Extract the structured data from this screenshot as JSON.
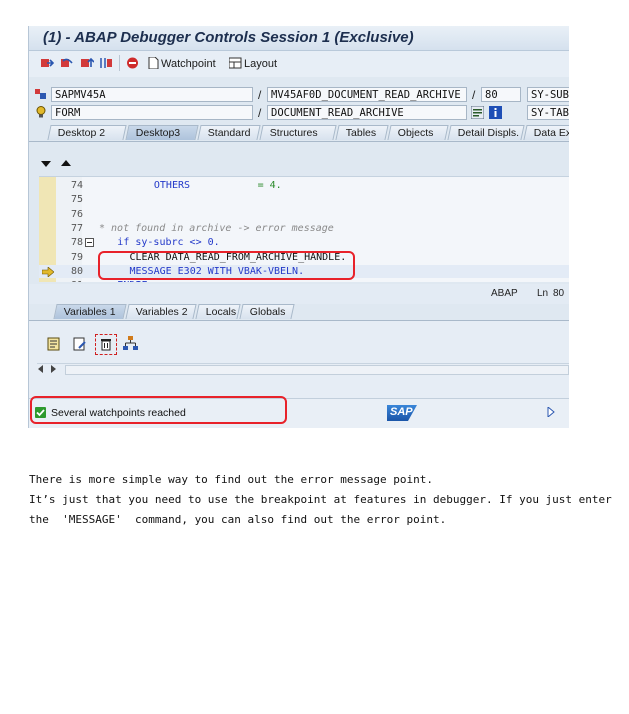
{
  "window": {
    "title": "(1) - ABAP Debugger Controls Session 1 (Exclusive)"
  },
  "toolbar": {
    "watchpoint_label": "Watchpoint",
    "layout_label": "Layout"
  },
  "context": {
    "program": "SAPMV45A",
    "include": "MV45AF0D_DOCUMENT_READ_ARCHIVE",
    "line": "80",
    "sysvar1": "SY-SUB",
    "event_type": "FORM",
    "event_name": "DOCUMENT_READ_ARCHIVE",
    "sysvar2": "SY-TAB"
  },
  "tabs": [
    "Desktop 2",
    "Desktop3",
    "Standard",
    "Structures",
    "Tables",
    "Objects",
    "Detail Displs.",
    "Data Explo"
  ],
  "active_tab": "Desktop3",
  "code": [
    {
      "n": "74",
      "text": "OTHERS",
      "extra": "= 4.",
      "style": "kw",
      "indent": 9
    },
    {
      "n": "75",
      "text": "",
      "style": "plain",
      "indent": 0
    },
    {
      "n": "76",
      "text": "",
      "style": "plain",
      "indent": 0
    },
    {
      "n": "77",
      "text": "* not found in archive -> error message",
      "style": "cm",
      "indent": 0
    },
    {
      "n": "78",
      "text": "if sy-subrc <> 0.",
      "style": "kw",
      "indent": 3
    },
    {
      "n": "79",
      "text": "CLEAR DATA_READ_FROM_ARCHIVE_HANDLE.",
      "style": "plain",
      "indent": 5
    },
    {
      "n": "80",
      "text": "MESSAGE E302 WITH VBAK-VBELN.",
      "style": "kw",
      "indent": 5
    },
    {
      "n": "81",
      "text": "ENDIF.",
      "style": "kw",
      "indent": 3
    }
  ],
  "editor_status": {
    "lang": "ABAP",
    "pos_label": "Ln",
    "pos_value": "80"
  },
  "subtabs": [
    "Variables 1",
    "Variables 2",
    "Locals",
    "Globals"
  ],
  "active_subtab": "Variables 1",
  "status": {
    "message": "Several watchpoints reached",
    "brand": "SAP"
  },
  "prose": [
    "There is more simple way to find out the error message point.",
    "It’s just that you need to use the breakpoint at features in debugger. If you just enter",
    "the  'MESSAGE'  command, you can also find out the error point."
  ],
  "colors": {
    "highlight": "#e8222a",
    "keyword": "#2339c9",
    "comment": "#8a8a8a"
  }
}
